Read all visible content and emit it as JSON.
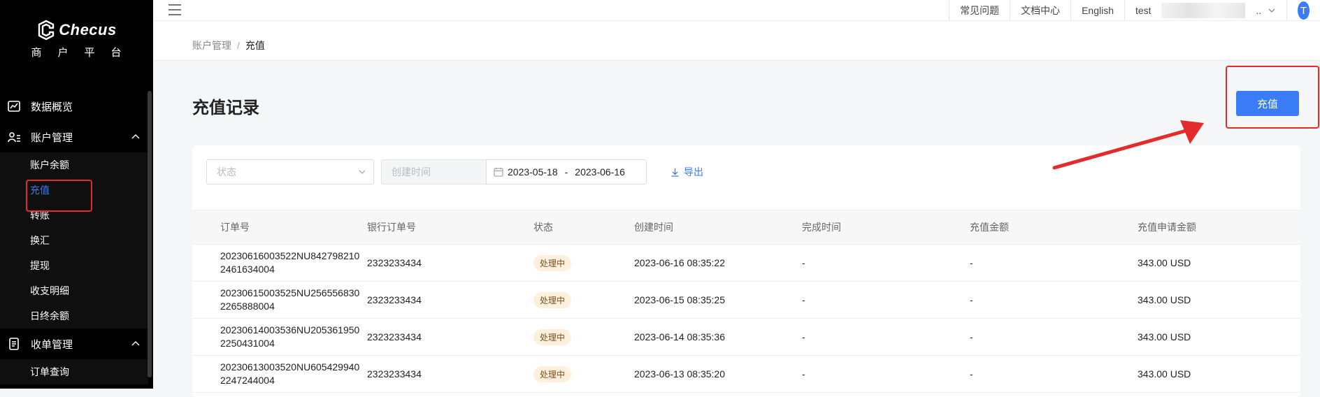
{
  "sidebar": {
    "logo_text": "Checus",
    "logo_sub": "商户平台",
    "groups": [
      {
        "label": "数据概览",
        "icon": "chart-icon"
      },
      {
        "label": "账户管理",
        "icon": "account-icon",
        "items": [
          "账户余额",
          "充值",
          "转账",
          "换汇",
          "提现",
          "收支明细",
          "日终余额"
        ]
      },
      {
        "label": "收单管理",
        "icon": "document-icon",
        "items": [
          "订单查询"
        ]
      }
    ]
  },
  "topbar": {
    "faq": "常见问题",
    "docs": "文档中心",
    "language": "English",
    "user_prefix": "test",
    "user_suffix": "..",
    "avatar_letter": "T"
  },
  "breadcrumb": {
    "parent": "账户管理",
    "separator": "/",
    "current": "充值"
  },
  "page": {
    "title": "充值记录",
    "recharge_button": "充值"
  },
  "filters": {
    "status_placeholder": "状态",
    "date_label": "创建时间",
    "date_start": "2023-05-18",
    "date_sep": "-",
    "date_end": "2023-06-16",
    "export": "导出"
  },
  "table": {
    "headers": [
      "订单号",
      "银行订单号",
      "状态",
      "创建时间",
      "完成时间",
      "充值金额",
      "充值申请金额"
    ],
    "rows": [
      {
        "order_no": "20230616003522NU8427982102461634004",
        "bank_order": "2323233434",
        "status": "处理中",
        "created": "2023-06-16 08:35:22",
        "completed": "-",
        "amount": "-",
        "apply_amount": "343.00 USD"
      },
      {
        "order_no": "20230615003525NU2565568302265888004",
        "bank_order": "2323233434",
        "status": "处理中",
        "created": "2023-06-15 08:35:25",
        "completed": "-",
        "amount": "-",
        "apply_amount": "343.00 USD"
      },
      {
        "order_no": "20230614003536NU2053619502250431004",
        "bank_order": "2323233434",
        "status": "处理中",
        "created": "2023-06-14 08:35:36",
        "completed": "-",
        "amount": "-",
        "apply_amount": "343.00 USD"
      },
      {
        "order_no": "20230613003520NU6054299402247244004",
        "bank_order": "2323233434",
        "status": "处理中",
        "created": "2023-06-13 08:35:20",
        "completed": "-",
        "amount": "-",
        "apply_amount": "343.00 USD"
      }
    ]
  },
  "colors": {
    "accent": "#3a7cf5",
    "highlight": "#e42b2b",
    "sidebar_bg": "#000000"
  }
}
